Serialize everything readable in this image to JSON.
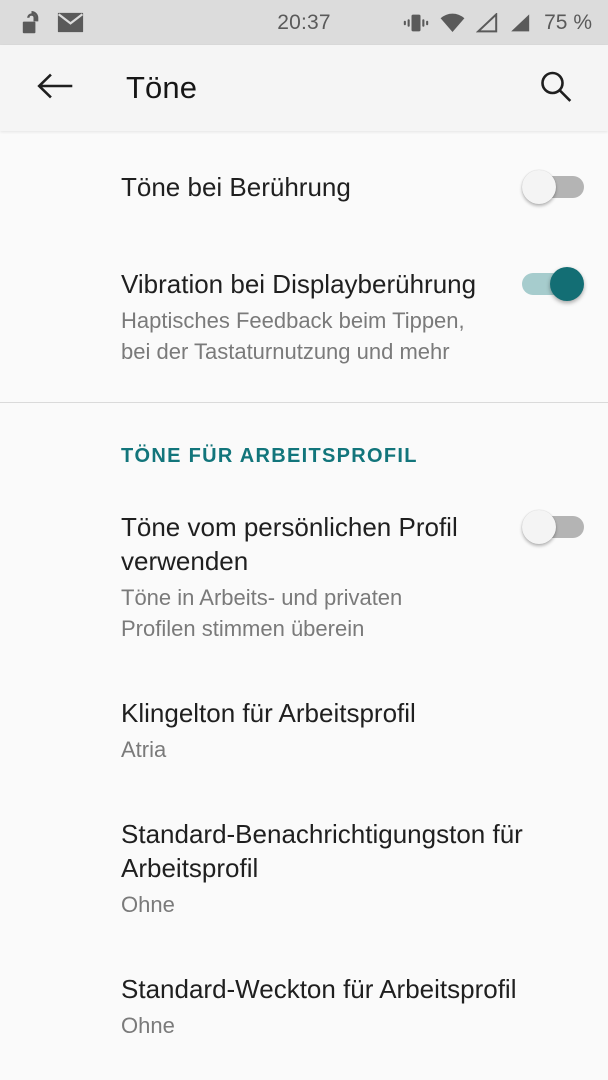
{
  "status_bar": {
    "icons_left": [
      "unlocked-padlock-icon",
      "email-envelope-icon"
    ],
    "clock": "20:37",
    "icons_right": [
      "vibrate-icon",
      "wifi-icon",
      "signal-empty-icon",
      "signal-full-icon"
    ],
    "battery": "75 %"
  },
  "toolbar": {
    "back_icon": "back-arrow-icon",
    "title": "Töne",
    "search_icon": "search-icon"
  },
  "preferences": [
    {
      "name": "touch-sounds",
      "title": "Töne bei Berührung",
      "summary": "",
      "control": "switch",
      "checked": false
    },
    {
      "name": "vibration-on-touch",
      "title": "Vibration bei Displayberührung",
      "summary": "Haptisches Feedback beim Tippen, bei der Tastaturnutzung und mehr",
      "control": "switch",
      "checked": true
    }
  ],
  "work_section": {
    "header": "Töne für Arbeitsprofil",
    "accent_color": "#12757b",
    "items": [
      {
        "name": "use-personal-profile-sounds",
        "title": "Töne vom persönlichen Profil verwenden",
        "summary": "Töne in Arbeits- und privaten Profilen stimmen überein",
        "control": "switch",
        "checked": false
      },
      {
        "name": "work-ringtone",
        "title": "Klingelton für Arbeitsprofil",
        "summary": "Atria",
        "control": "none",
        "checked": null
      },
      {
        "name": "work-default-notification-sound",
        "title": "Standard-Benachrichtigungston für Arbeitsprofil",
        "summary": "Ohne",
        "control": "none",
        "checked": null
      },
      {
        "name": "work-default-alarm-sound",
        "title": "Standard-Weckton für Arbeitsprofil",
        "summary": "Ohne",
        "control": "none",
        "checked": null
      }
    ]
  },
  "colors": {
    "status_bar_bg": "#dcdcdc",
    "toolbar_bg": "#f5f5f5",
    "content_bg": "#fafafa",
    "accent_teal": "#136e74",
    "switch_off_track": "#b4b4b4",
    "title_text": "#1f1f1f",
    "summary_text": "#7a7a7a"
  }
}
